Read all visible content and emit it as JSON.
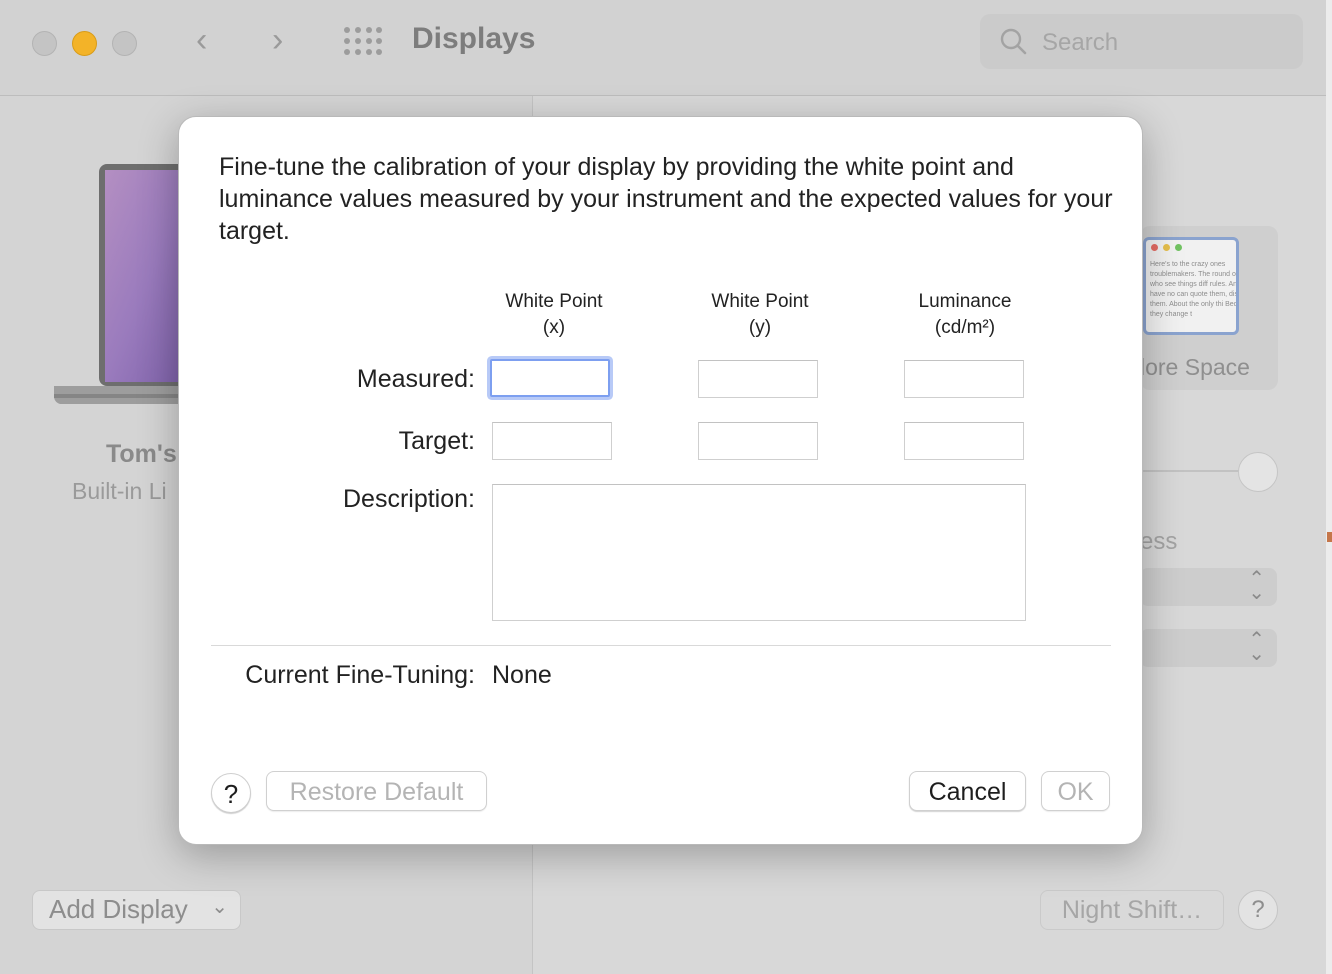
{
  "window": {
    "title": "Displays",
    "search_placeholder": "Search"
  },
  "sidebar": {
    "display_name": "Tom's",
    "display_sub": "Built-in Li",
    "add_display": "Add Display"
  },
  "right_panel": {
    "thumb_label": "lore Space",
    "thumb_text": "Here's to the crazy ones troublemakers. The round ones who see things diff rules. And they have no can quote them, disagree them. About the only thi Because they change t",
    "brightness_fragment": "ess",
    "night_shift": "Night Shift…",
    "help": "?"
  },
  "dialog": {
    "intro": "Fine-tune the calibration of your display by providing the white point and luminance values measured by your instrument and the expected values for your target.",
    "columns": [
      {
        "line1": "White Point",
        "line2": "(x)"
      },
      {
        "line1": "White Point",
        "line2": "(y)"
      },
      {
        "line1": "Luminance",
        "line2": "(cd/m²)"
      }
    ],
    "rows": {
      "measured": "Measured:",
      "target": "Target:",
      "description": "Description:"
    },
    "current_label": "Current Fine-Tuning:",
    "current_value": "None",
    "buttons": {
      "help": "?",
      "restore_default": "Restore Default",
      "cancel": "Cancel",
      "ok": "OK"
    }
  },
  "colors": {
    "focus_ring": "#7d9ff0",
    "minimize": "#f3b328"
  }
}
